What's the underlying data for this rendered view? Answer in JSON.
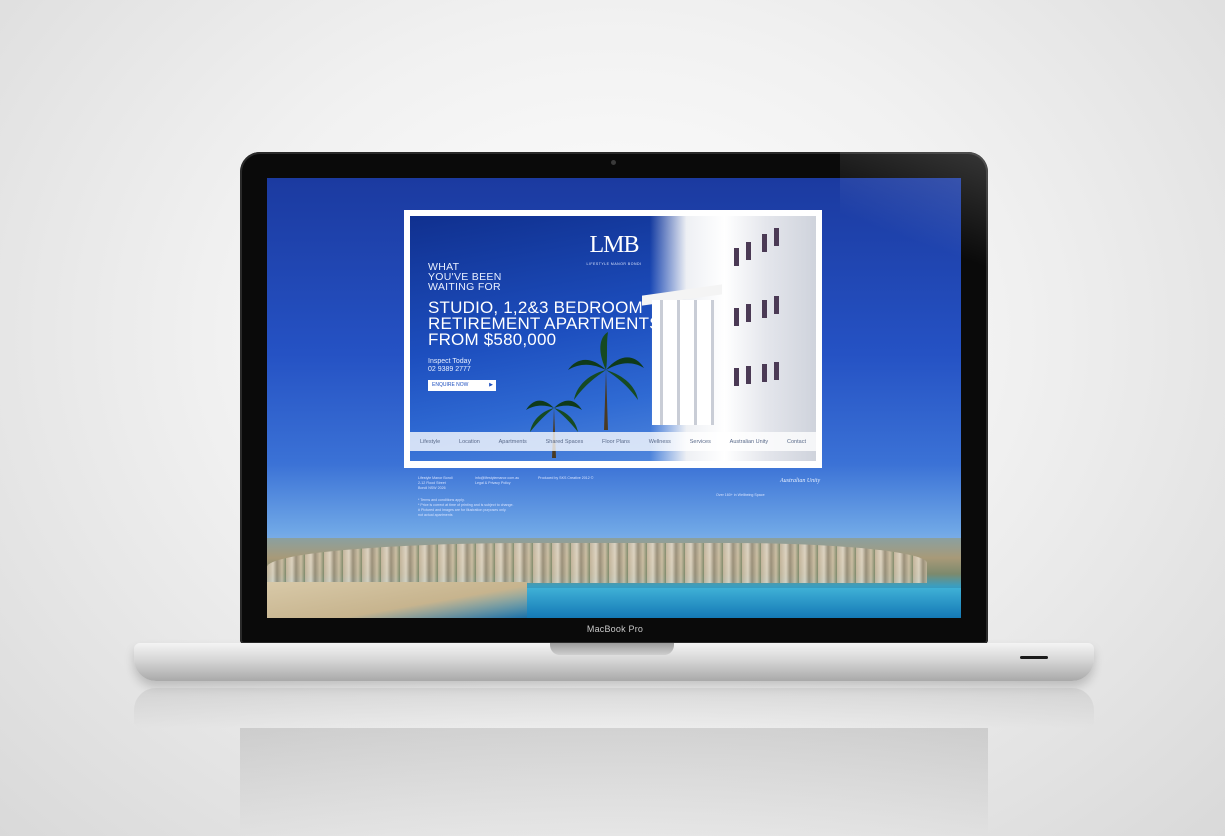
{
  "laptop": {
    "label": "MacBook Pro"
  },
  "website": {
    "logo": "LMB",
    "logo_subtitle": "LIFESTYLE MANOR BONDI",
    "headline_small": [
      "WHAT",
      "YOU'VE BEEN",
      "WAITING FOR"
    ],
    "headline_big": [
      "STUDIO, 1,2&3 BEDROOM",
      "RETIREMENT APARTMENTS",
      "FROM $580,000"
    ],
    "inspect_label": "Inspect Today",
    "phone": "02 9389 2777",
    "cta_label": "ENQUIRE NOW",
    "cta_arrow": "▶",
    "nav": [
      "Lifestyle",
      "Location",
      "Apartments",
      "Shared Spaces",
      "Floor Plans",
      "Wellness",
      "Services",
      "Australian Unity",
      "Contact"
    ],
    "footer": {
      "address": [
        "Lifestyle Manor Bondi",
        "2-12 Flood Street",
        "Bondi NSW 2026"
      ],
      "contact": [
        "info@lifestylemanor.com.au",
        "Legal & Privacy Policy"
      ],
      "credit": "Produced by SKS Creative 2012 ©",
      "notes": [
        "* Terms and conditions apply.",
        "* Price is correct at time of printing and is subject to change.",
        "# Pictured and images are for illustration purposes only.",
        "not actual apartments"
      ]
    },
    "partner_logo": "Australian Unity",
    "partner_tagline": "Over 160+ in Wellbeing Space"
  },
  "colors": {
    "screen_blue": "#2552c4",
    "panel_white": "#ffffff",
    "cta_text": "#1d4fbf"
  }
}
